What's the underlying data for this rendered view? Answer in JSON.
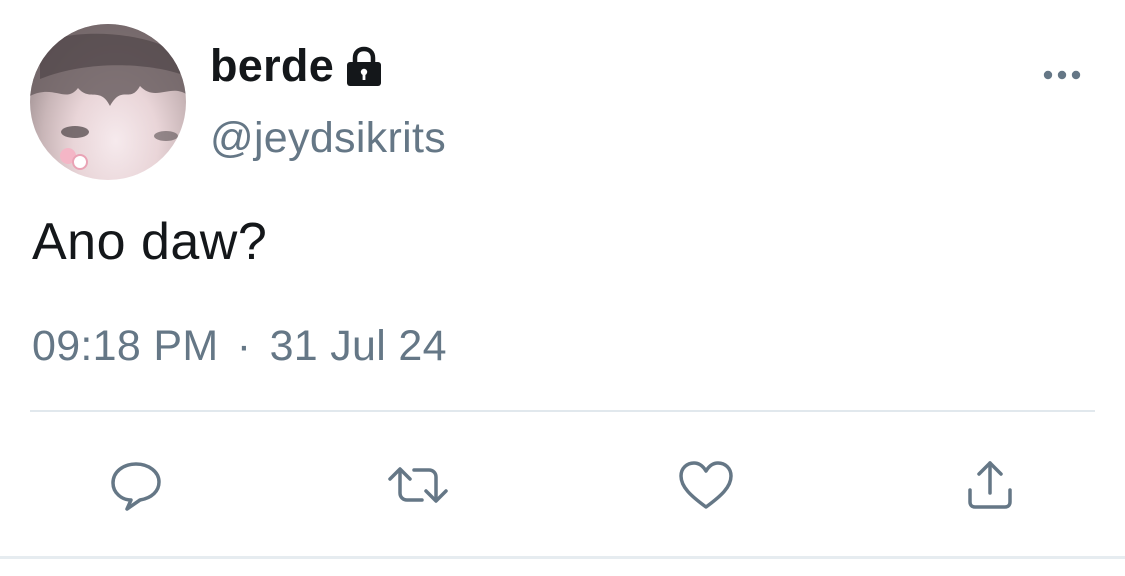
{
  "user": {
    "display_name": "berde",
    "handle": "@jeydsikrits",
    "protected_icon": "lock-icon",
    "avatar": "profile-photo"
  },
  "tweet": {
    "text": "Ano daw?",
    "time": "09:18 PM",
    "separator": "·",
    "date": "31 Jul 24"
  },
  "actions": [
    {
      "name": "reply",
      "icon": "speech-bubble-icon"
    },
    {
      "name": "retweet",
      "icon": "retweet-icon"
    },
    {
      "name": "like",
      "icon": "heart-icon"
    },
    {
      "name": "share",
      "icon": "share-icon"
    }
  ],
  "menu_icon": "more-dots-icon",
  "colors": {
    "text_primary": "#14171a",
    "text_secondary": "#657786",
    "divider": "#e1e8ed"
  }
}
